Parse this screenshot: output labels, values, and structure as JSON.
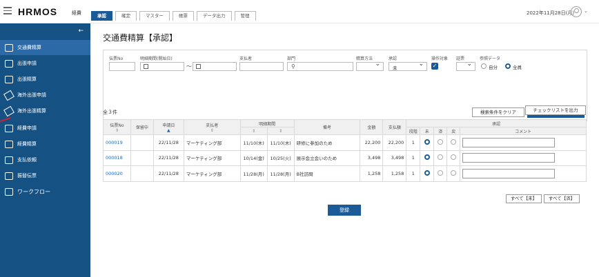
{
  "header": {
    "logo": "HRMOS",
    "logo_sub": "経費",
    "tabs": [
      {
        "label": "承認",
        "active": true
      },
      {
        "label": "確定",
        "active": false
      },
      {
        "label": "マスター",
        "active": false
      },
      {
        "label": "帳票",
        "active": false
      },
      {
        "label": "データ出力",
        "active": false
      },
      {
        "label": "管理",
        "active": false
      }
    ],
    "date": "2022年11月28日(月)",
    "icons": [
      "hamburger-icon",
      "user-icon",
      "chevron-down-icon"
    ]
  },
  "sidebar": {
    "collapse_icon": "chevron-left-icon",
    "items": [
      {
        "label": "交通費精算",
        "icon": "train-card-icon",
        "active": true
      },
      {
        "label": "出張申請",
        "icon": "suitcase-icon",
        "active": false
      },
      {
        "label": "出張精算",
        "icon": "suitcase-icon",
        "active": false
      },
      {
        "label": "海外出張申請",
        "icon": "airplane-icon",
        "active": false
      },
      {
        "label": "海外出張精算",
        "icon": "airplane-icon",
        "active": false
      },
      {
        "label": "経費申請",
        "icon": "receipt-icon",
        "active": false
      },
      {
        "label": "経費精算",
        "icon": "receipt-icon",
        "active": false
      },
      {
        "label": "支払依頼",
        "icon": "payment-icon",
        "active": false
      },
      {
        "label": "振替伝票",
        "icon": "transfer-icon",
        "active": false
      },
      {
        "label": "ワークフロー",
        "icon": "document-icon",
        "active": false
      }
    ]
  },
  "main": {
    "title": "交通費精算【承認】",
    "search": {
      "labels": {
        "slip_no": "伝票No",
        "period": "明細期間(開始日)",
        "payer": "支払者",
        "department": "部門",
        "method": "精算方法",
        "approval": "承認",
        "target": "操作対象",
        "slip": "証票",
        "ref_data": "参照データ"
      },
      "approval_value": "未",
      "target_checked": true,
      "ref_options": [
        {
          "label": "自分",
          "selected": false
        },
        {
          "label": "全員",
          "selected": true
        }
      ],
      "period_separator": "～",
      "clear_label": "検索条件をクリア",
      "search_label": "この条件で検索"
    },
    "count_text": "全３件",
    "checklist_label": "チェックリストを出力",
    "table": {
      "headers": {
        "slip_no": "伝票No",
        "holding": "保留中",
        "apply_date": "申請日",
        "payer": "支払者",
        "period_group": "明細期間",
        "remarks": "備考",
        "amount": "金額",
        "paid_amount": "支払額",
        "stage": "段階",
        "approval_group": "承認",
        "not_yet": "未",
        "done": "済",
        "reject": "戻",
        "comment": "コメント"
      },
      "rows": [
        {
          "slip_no": "000019",
          "holding": "",
          "apply_date": "22/11/28",
          "payer": "マーケティング部",
          "from": "11/10(木)",
          "to": "11/10(木)",
          "remarks": "研修に参加のため",
          "amount": "22,200",
          "paid": "22,200",
          "stage": "1",
          "status": "未"
        },
        {
          "slip_no": "000018",
          "holding": "",
          "apply_date": "22/11/28",
          "payer": "マーケティング部",
          "from": "10/14(金)",
          "to": "10/25(火)",
          "remarks": "展示会立会いのため",
          "amount": "3,498",
          "paid": "3,498",
          "stage": "1",
          "status": "未"
        },
        {
          "slip_no": "000020",
          "holding": "",
          "apply_date": "22/11/28",
          "payer": "マーケティング部",
          "from": "11/28(月)",
          "to": "11/28(月)",
          "remarks": "B社訪問",
          "amount": "1,258",
          "paid": "1,258",
          "stage": "1",
          "status": "未"
        }
      ]
    },
    "all_mi_label": "すべて【未】",
    "all_sumi_label": "すべて【済】",
    "register_label": "登録"
  },
  "colors": {
    "brand": "#1a5a96",
    "sidebar": "#155183",
    "sidebar_active": "#2b6aa7",
    "annotation_red": "#d21f2c"
  }
}
